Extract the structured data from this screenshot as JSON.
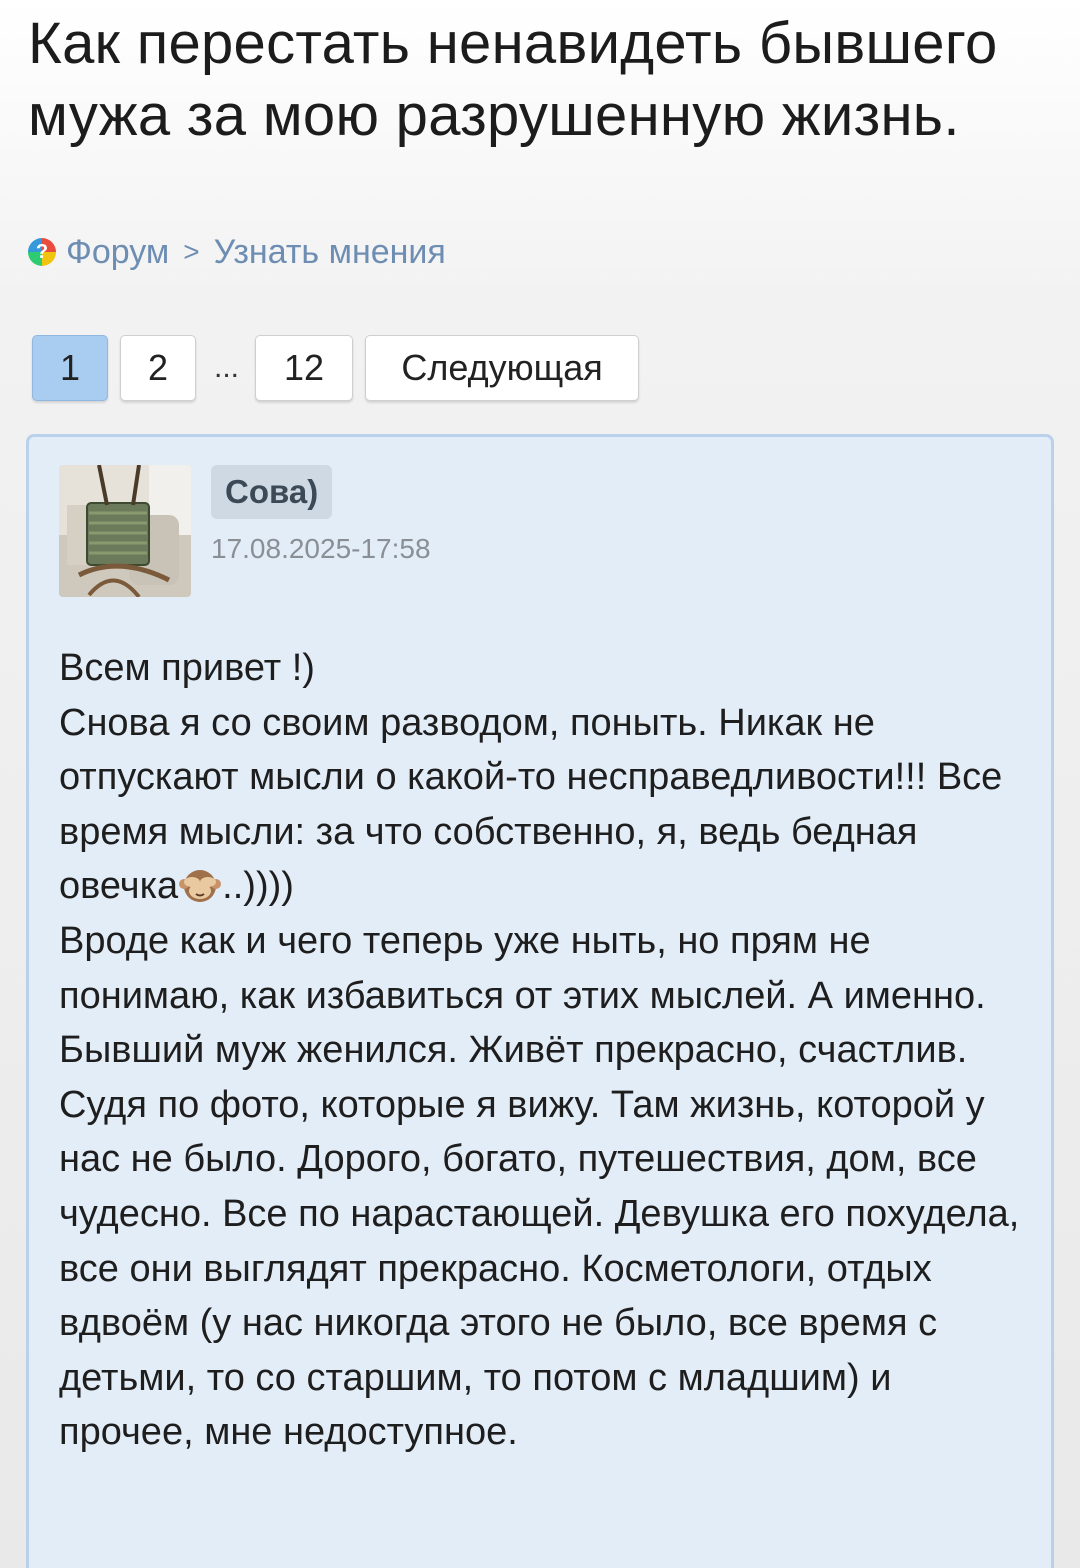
{
  "page": {
    "title": "Как перестать ненавидеть бывшего мужа за мою разрушенную жизнь."
  },
  "breadcrumb": {
    "icon": "forum-question-icon",
    "icon_glyph": "?",
    "forum_label": "Форум",
    "separator": ">",
    "section_label": "Узнать мнения"
  },
  "pagination": {
    "pages": [
      "1",
      "2",
      "12"
    ],
    "active_page": "1",
    "ellipsis": "...",
    "next_label": "Следующая"
  },
  "post": {
    "author": "Сова)",
    "date": "17.08.2025-17:58",
    "avatar_icon": "user-avatar-photo",
    "emoji_icon": "see-no-evil-monkey-icon",
    "lines": {
      "l1": "Всем привет !)",
      "l2": "Снова я со своим разводом, поныть. Никак не отпускают мысли о какой-то несправедливости!!! Все время мысли: за что собственно, я, ведь бедная овечка",
      "l2_tail": "..))))",
      "l3": "Вроде как и чего теперь уже ныть, но прям не понимаю, как избавиться от этих мыслей. А именно.",
      "l4": "Бывший муж женился. Живёт прекрасно, счастлив. Судя по фото, которые я вижу. Там жизнь, которой у нас не было. Дорого, богато, путешествия, дом, все чудесно. Все по нарастающей. Девушка его похудела, все они выглядят прекрасно. Косметологи, отдых вдвоём (у нас никогда этого не было, все время с детьми, то со старшим, то потом с младшим) и прочее, мне недоступное."
    }
  },
  "colors": {
    "link": "#6d8db3",
    "active_page": "#a9cdf0",
    "post_bg": "#e3edf8",
    "post_border": "#b9d1ea"
  }
}
